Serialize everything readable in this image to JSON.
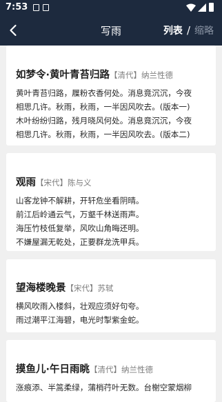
{
  "status": {
    "time": "7:53"
  },
  "nav": {
    "title": "写雨",
    "tab_list": "列表",
    "separator": "/",
    "tab_brief": "缩略"
  },
  "poems": [
    {
      "title": "如梦令·黄叶青苔归路",
      "dynasty": "【清代】",
      "author": "纳兰性德",
      "lines": [
        "黄叶青苔归路，屧粉衣香何处。消息竟沉沉，今夜",
        "相思几许。秋雨，秋雨，一半因风吹去。(版本一)",
        "木叶纷纷归路，残月晓风何处。消息竟沉沉，今夜",
        "相思几许。秋雨，秋雨，一半因风吹去。(版本二)"
      ]
    },
    {
      "title": "观雨",
      "dynasty": "【宋代】",
      "author": "陈与义",
      "lines": [
        "山客龙钟不解耕，开轩危坐看阴晴。",
        "前江后岭通云气，万壑千林送雨声。",
        "海压竹枝低复举，风吹山角晦还明。",
        "不嫌屋漏无乾处，正要群龙洗甲兵。"
      ]
    },
    {
      "title": "望海楼晚景",
      "dynasty": "【宋代】",
      "author": "苏轼",
      "lines": [
        "横风吹雨入楼斜，壮观应须好句夸。",
        "雨过潮平江海碧，电光时掣紫金蛇。"
      ]
    },
    {
      "title": "摸鱼儿·午日雨眺",
      "dynasty": "【清代】",
      "author": "纳兰性德",
      "lines": [
        "涨痕添、半篙柔绿，蒲梢荇叶无数。台榭空蒙烟柳"
      ]
    }
  ]
}
